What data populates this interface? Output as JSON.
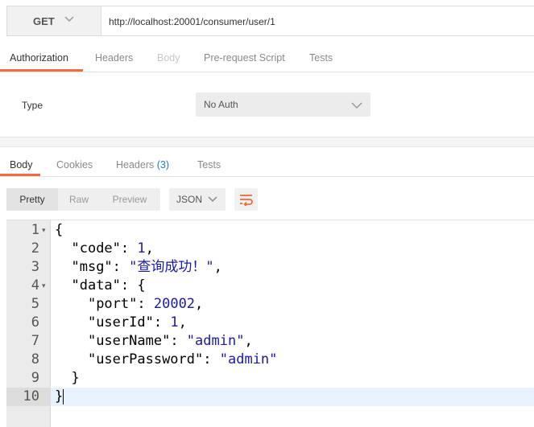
{
  "request": {
    "method": "GET",
    "url": "http://localhost:20001/consumer/user/1"
  },
  "request_tabs": [
    "Authorization",
    "Headers",
    "Body",
    "Pre-request Script",
    "Tests"
  ],
  "auth": {
    "type_label": "Type",
    "selected": "No Auth"
  },
  "response_tabs": {
    "body": "Body",
    "cookies": "Cookies",
    "headers": "Headers",
    "headers_count": "(3)",
    "tests": "Tests"
  },
  "format": {
    "modes": [
      "Pretty",
      "Raw",
      "Preview"
    ],
    "language": "JSON"
  },
  "editor": {
    "line_numbers": [
      "1",
      "2",
      "3",
      "4",
      "5",
      "6",
      "7",
      "8",
      "9",
      "10"
    ],
    "active_line": 10,
    "response": {
      "code": "1",
      "msg": "查询成功！",
      "data": {
        "port": "20002",
        "userId": "1",
        "userName": "admin",
        "userPassword": "admin"
      }
    }
  },
  "colors": {
    "accent": "#f26b3a",
    "string": "#1a1aa6",
    "badge": "#1e79d9"
  }
}
